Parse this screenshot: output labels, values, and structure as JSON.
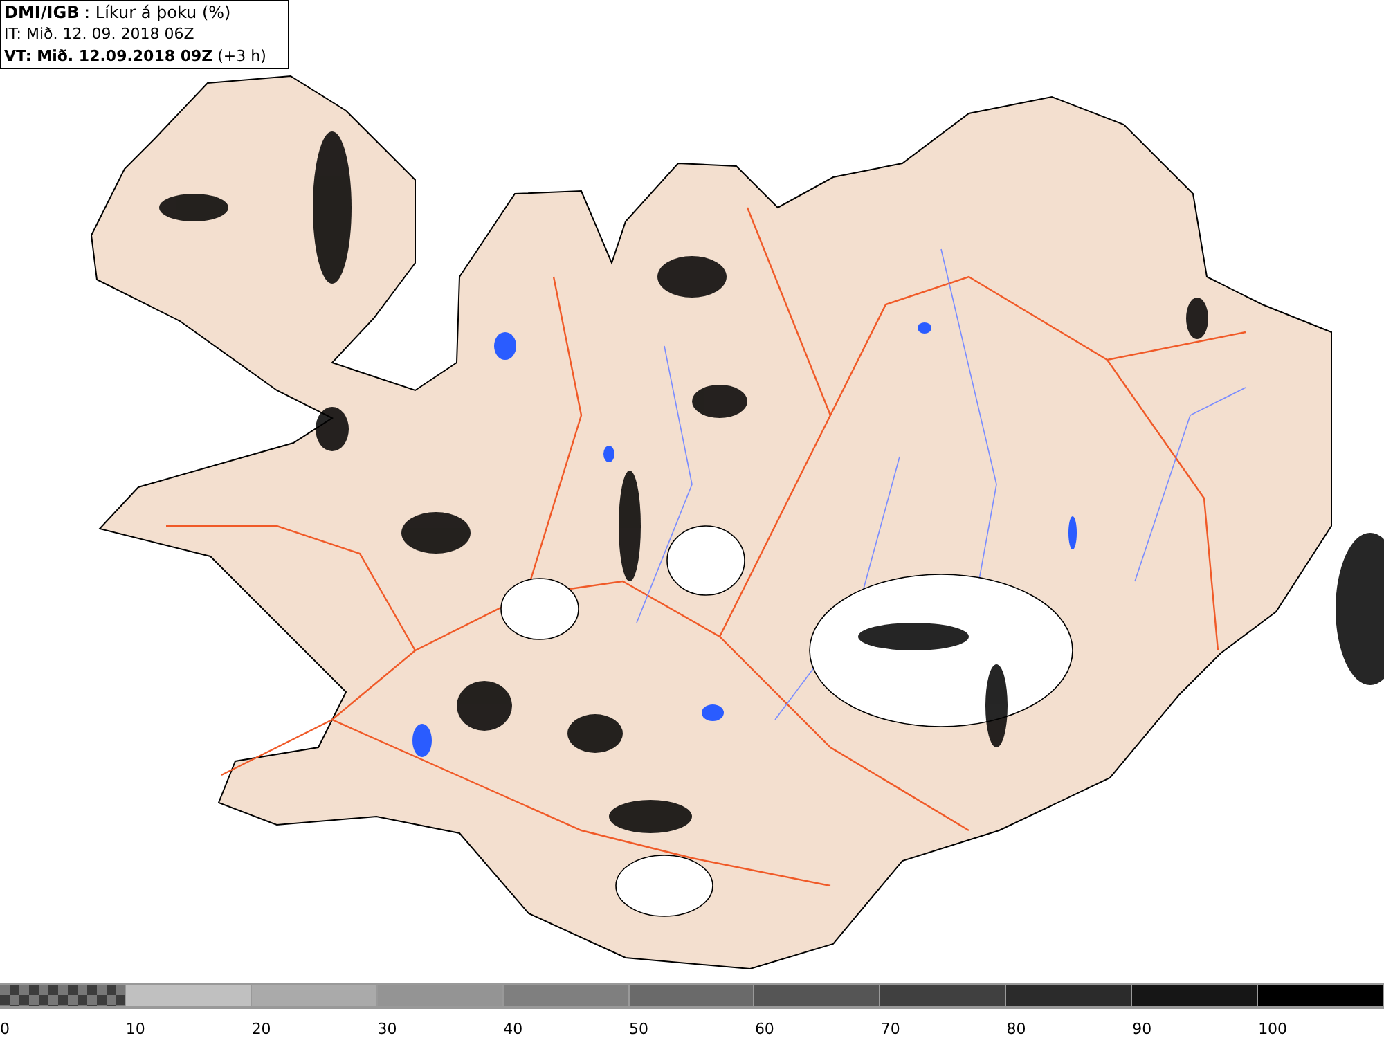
{
  "header": {
    "lines": [
      "**DMI/IGB** : Líkur á þoku (%)",
      "IT: Mið. 12. 09. 2018 06Z",
      "**VT: Mið. 12.09.2018 09Z** (+3 h)"
    ]
  },
  "legend": {
    "items": [
      {
        "label": "0",
        "kind": "checker",
        "color": "#3c3c3c"
      },
      {
        "label": "10",
        "kind": "solid",
        "color": "#c0c0c0"
      },
      {
        "label": "20",
        "kind": "solid",
        "color": "#aaaaaa"
      },
      {
        "label": "30",
        "kind": "solid",
        "color": "#949494"
      },
      {
        "label": "40",
        "kind": "solid",
        "color": "#7f7f7f"
      },
      {
        "label": "50",
        "kind": "solid",
        "color": "#6a6a6a"
      },
      {
        "label": "60",
        "kind": "solid",
        "color": "#555555"
      },
      {
        "label": "70",
        "kind": "solid",
        "color": "#404040"
      },
      {
        "label": "80",
        "kind": "solid",
        "color": "#2b2b2b"
      },
      {
        "label": "90",
        "kind": "solid",
        "color": "#161616"
      },
      {
        "label": "100",
        "kind": "solid",
        "color": "#000000"
      }
    ]
  }
}
